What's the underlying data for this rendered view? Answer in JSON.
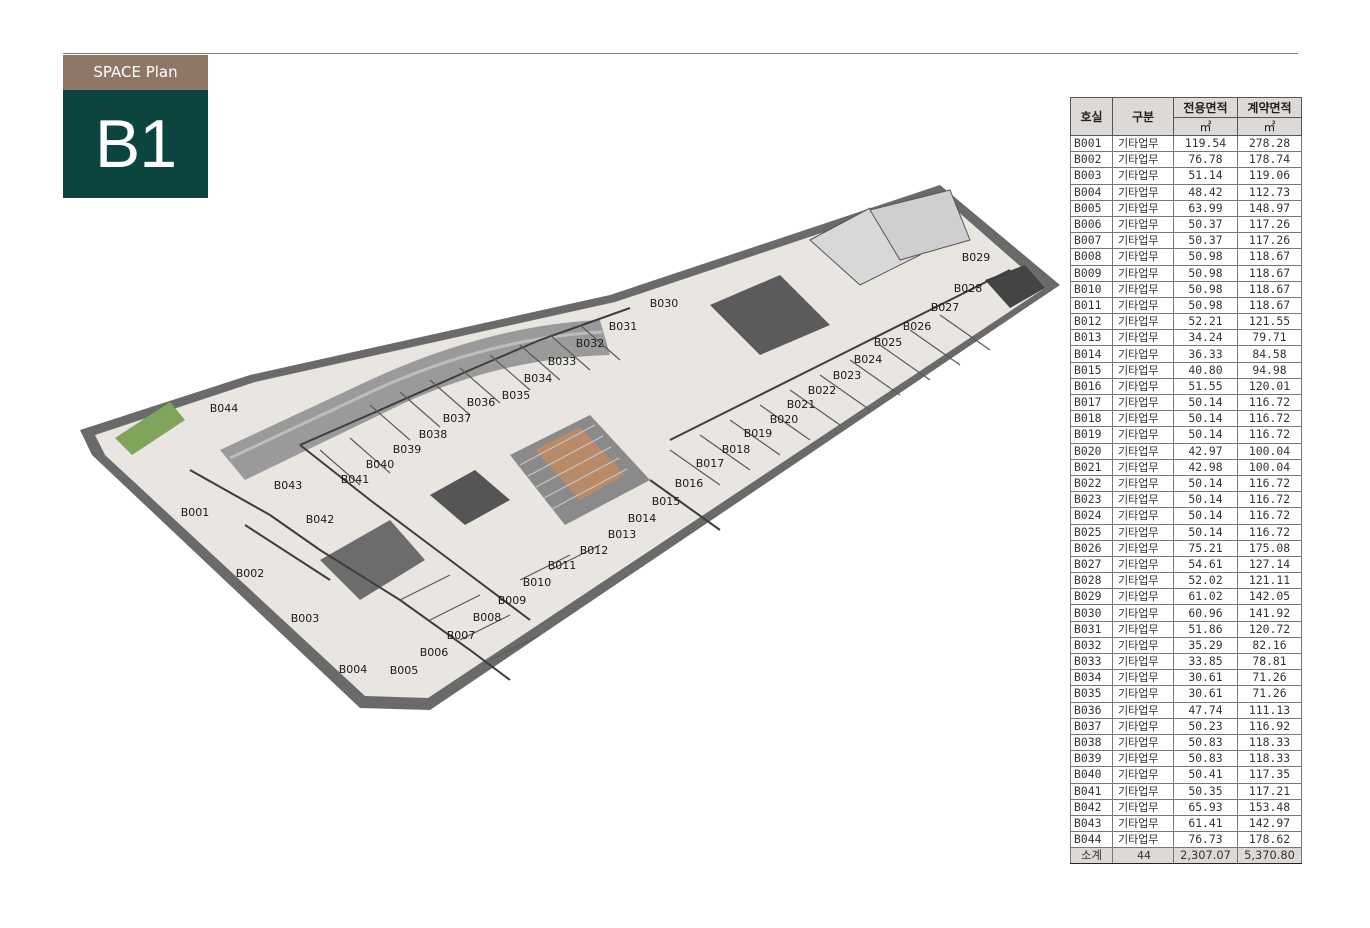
{
  "header": {
    "brand_tag": "SPACE Plan",
    "floor": "B1"
  },
  "plan": {
    "unit_labels": [
      "B001",
      "B002",
      "B003",
      "B004",
      "B005",
      "B006",
      "B007",
      "B008",
      "B009",
      "B010",
      "B011",
      "B012",
      "B013",
      "B014",
      "B015",
      "B016",
      "B017",
      "B018",
      "B019",
      "B020",
      "B021",
      "B022",
      "B023",
      "B024",
      "B025",
      "B026",
      "B027",
      "B028",
      "B029",
      "B030",
      "B031",
      "B032",
      "B033",
      "B034",
      "B035",
      "B036",
      "B037",
      "B038",
      "B039",
      "B040",
      "B041",
      "B042",
      "B043",
      "B044"
    ]
  },
  "table": {
    "headers": {
      "room": "호실",
      "category": "구분",
      "exclusive_area": "전용면적",
      "contract_area": "계약면적",
      "unit": "㎡"
    },
    "rows": [
      [
        "B001",
        "기타업무",
        "119.54",
        "278.28"
      ],
      [
        "B002",
        "기타업무",
        "76.78",
        "178.74"
      ],
      [
        "B003",
        "기타업무",
        "51.14",
        "119.06"
      ],
      [
        "B004",
        "기타업무",
        "48.42",
        "112.73"
      ],
      [
        "B005",
        "기타업무",
        "63.99",
        "148.97"
      ],
      [
        "B006",
        "기타업무",
        "50.37",
        "117.26"
      ],
      [
        "B007",
        "기타업무",
        "50.37",
        "117.26"
      ],
      [
        "B008",
        "기타업무",
        "50.98",
        "118.67"
      ],
      [
        "B009",
        "기타업무",
        "50.98",
        "118.67"
      ],
      [
        "B010",
        "기타업무",
        "50.98",
        "118.67"
      ],
      [
        "B011",
        "기타업무",
        "50.98",
        "118.67"
      ],
      [
        "B012",
        "기타업무",
        "52.21",
        "121.55"
      ],
      [
        "B013",
        "기타업무",
        "34.24",
        "79.71"
      ],
      [
        "B014",
        "기타업무",
        "36.33",
        "84.58"
      ],
      [
        "B015",
        "기타업무",
        "40.80",
        "94.98"
      ],
      [
        "B016",
        "기타업무",
        "51.55",
        "120.01"
      ],
      [
        "B017",
        "기타업무",
        "50.14",
        "116.72"
      ],
      [
        "B018",
        "기타업무",
        "50.14",
        "116.72"
      ],
      [
        "B019",
        "기타업무",
        "50.14",
        "116.72"
      ],
      [
        "B020",
        "기타업무",
        "42.97",
        "100.04"
      ],
      [
        "B021",
        "기타업무",
        "42.98",
        "100.04"
      ],
      [
        "B022",
        "기타업무",
        "50.14",
        "116.72"
      ],
      [
        "B023",
        "기타업무",
        "50.14",
        "116.72"
      ],
      [
        "B024",
        "기타업무",
        "50.14",
        "116.72"
      ],
      [
        "B025",
        "기타업무",
        "50.14",
        "116.72"
      ],
      [
        "B026",
        "기타업무",
        "75.21",
        "175.08"
      ],
      [
        "B027",
        "기타업무",
        "54.61",
        "127.14"
      ],
      [
        "B028",
        "기타업무",
        "52.02",
        "121.11"
      ],
      [
        "B029",
        "기타업무",
        "61.02",
        "142.05"
      ],
      [
        "B030",
        "기타업무",
        "60.96",
        "141.92"
      ],
      [
        "B031",
        "기타업무",
        "51.86",
        "120.72"
      ],
      [
        "B032",
        "기타업무",
        "35.29",
        "82.16"
      ],
      [
        "B033",
        "기타업무",
        "33.85",
        "78.81"
      ],
      [
        "B034",
        "기타업무",
        "30.61",
        "71.26"
      ],
      [
        "B035",
        "기타업무",
        "30.61",
        "71.26"
      ],
      [
        "B036",
        "기타업무",
        "47.74",
        "111.13"
      ],
      [
        "B037",
        "기타업무",
        "50.23",
        "116.92"
      ],
      [
        "B038",
        "기타업무",
        "50.83",
        "118.33"
      ],
      [
        "B039",
        "기타업무",
        "50.83",
        "118.33"
      ],
      [
        "B040",
        "기타업무",
        "50.41",
        "117.35"
      ],
      [
        "B041",
        "기타업무",
        "50.35",
        "117.21"
      ],
      [
        "B042",
        "기타업무",
        "65.93",
        "153.48"
      ],
      [
        "B043",
        "기타업무",
        "61.41",
        "142.97"
      ],
      [
        "B044",
        "기타업무",
        "76.73",
        "178.62"
      ]
    ],
    "total": [
      "소계",
      "44",
      "2,307.07",
      "5,370.80"
    ]
  }
}
